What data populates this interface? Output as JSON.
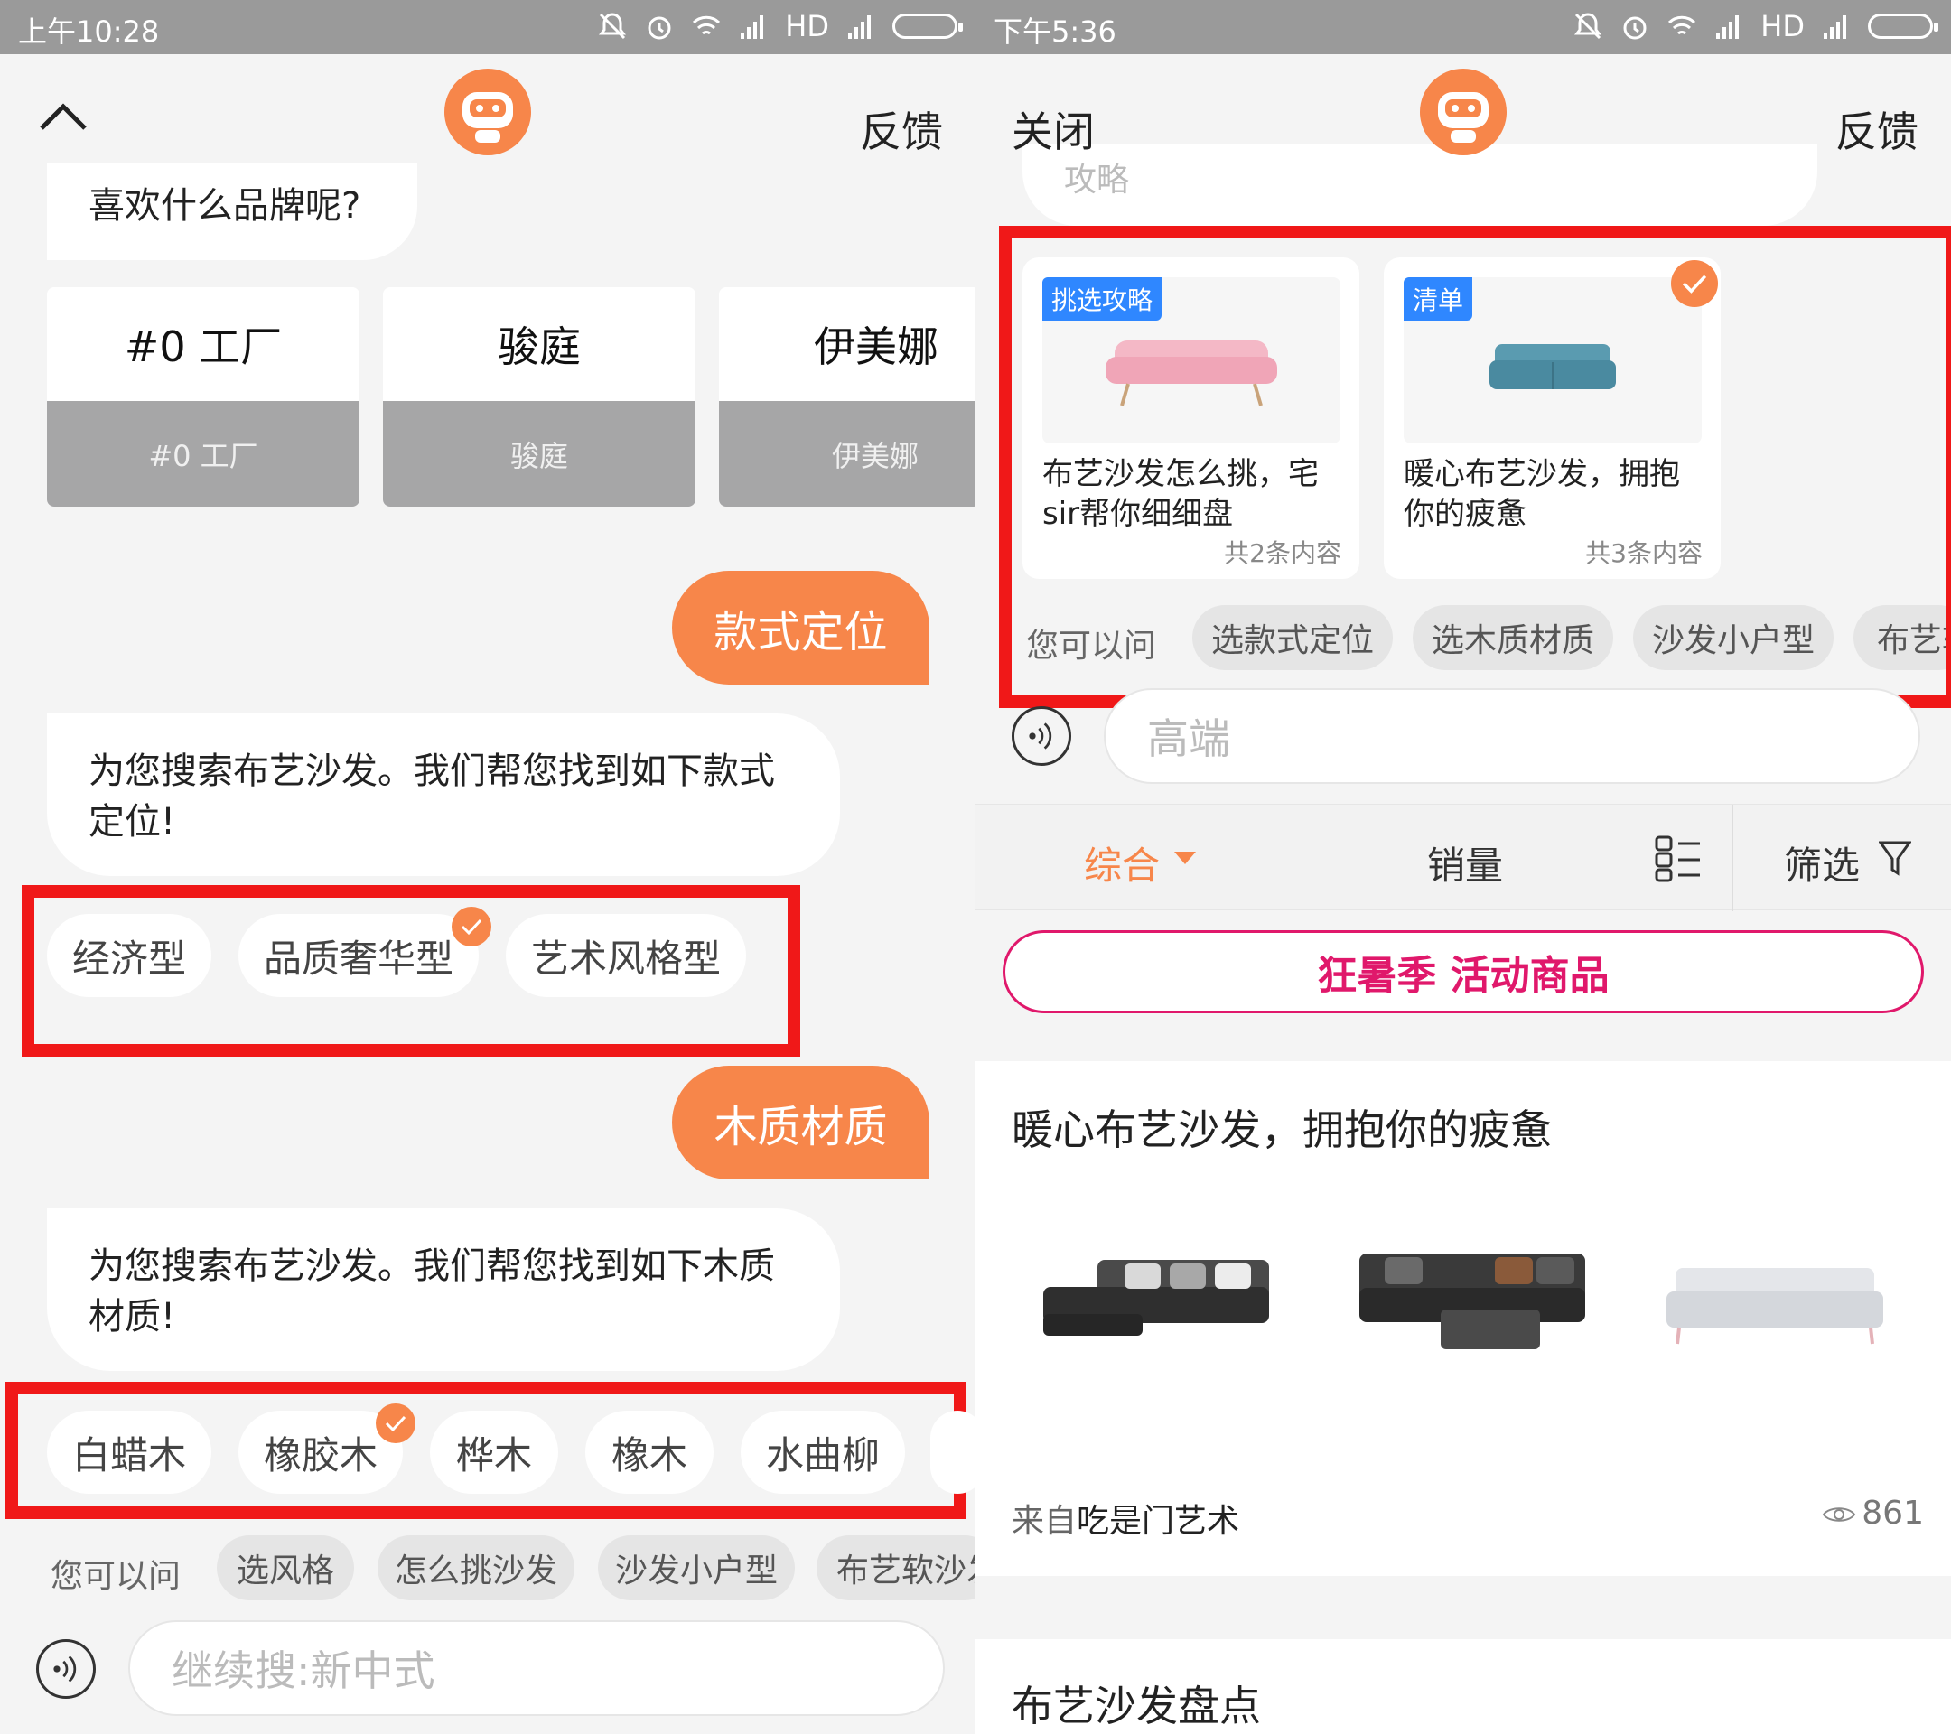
{
  "left": {
    "status": {
      "time": "上午10:28",
      "hd": "HD"
    },
    "header": {
      "feedback": "反馈"
    },
    "bubble_brand": "喜欢什么品牌呢?",
    "brands": [
      {
        "name": "#0 工厂",
        "sub": "#0 工厂"
      },
      {
        "name": "骏庭",
        "sub": "骏庭"
      },
      {
        "name": "伊美娜",
        "sub": "伊美娜"
      }
    ],
    "user_reply_1": "款式定位",
    "bot_reply_1": "为您搜索布艺沙发。我们帮您找到如下款式定位!",
    "style_chips": [
      "经济型",
      "品质奢华型",
      "艺术风格型"
    ],
    "user_reply_2": "木质材质",
    "bot_reply_2": "为您搜索布艺沙发。我们帮您找到如下木质材质!",
    "wood_chips": [
      "白蜡木",
      "橡胶木",
      "桦木",
      "橡木",
      "水曲柳"
    ],
    "ask": {
      "label": "您可以问",
      "chips": [
        "选风格",
        "怎么挑沙发",
        "沙发小户型",
        "布艺软沙发"
      ]
    },
    "input_placeholder": "继续搜:新中式"
  },
  "right": {
    "status": {
      "time": "下午5:36",
      "hd": "HD"
    },
    "header": {
      "close": "关闭",
      "feedback": "反馈"
    },
    "prev_bubble": "攻略",
    "cards": [
      {
        "tag": "挑选攻略",
        "title": "布艺沙发怎么挑，宅sir帮你细细盘",
        "count": "共2条内容"
      },
      {
        "tag": "清单",
        "title": "暖心布艺沙发，拥抱你的疲惫",
        "count": "共3条内容"
      }
    ],
    "ask": {
      "label": "您可以问",
      "chips": [
        "选款式定位",
        "选木质材质",
        "沙发小户型",
        "布艺软"
      ]
    },
    "input_value": "高端",
    "sort": {
      "general": "综合",
      "sales": "销量",
      "filter": "筛选"
    },
    "promo": "狂暑季  活动商品",
    "article1": {
      "title": "暖心布艺沙发，拥抱你的疲惫",
      "source_prefix": "来自",
      "source": "吃是门艺术",
      "views": "861"
    },
    "article2": {
      "title": "布艺沙发盘点"
    }
  },
  "colors": {
    "accent": "#f7864a",
    "highlight": "#f01818",
    "promo": "#e0186b",
    "tag": "#2f87ff"
  }
}
